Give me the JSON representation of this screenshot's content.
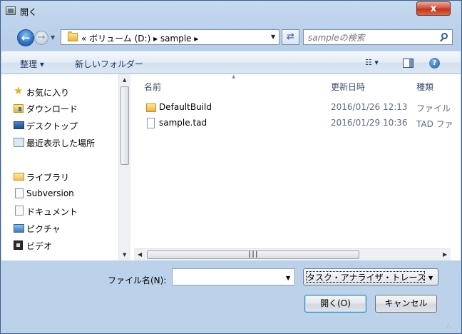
{
  "window": {
    "title": "開く",
    "close_label": "x"
  },
  "nav": {
    "address_path": "« ボリューム (D:) ▸ sample ▸",
    "search_placeholder": "sampleの検索"
  },
  "toolbar": {
    "organize_label": "整理 ▾",
    "new_folder_label": "新しいフォルダー"
  },
  "sidebar": {
    "favorites": "お気に入り",
    "downloads": "ダウンロード",
    "desktop": "デスクトップ",
    "recent": "最近表示した場所",
    "libraries": "ライブラリ",
    "subversion": "Subversion",
    "documents": "ドキュメント",
    "pictures": "ピクチャ",
    "videos": "ビデオ"
  },
  "columns": {
    "name": "名前",
    "modified": "更新日時",
    "type": "種類"
  },
  "files": [
    {
      "name": "DefaultBuild",
      "date": "2016/01/26 12:13",
      "type": "ファイル"
    },
    {
      "name": "sample.tad",
      "date": "2016/01/29 10:36",
      "type": "TAD ファ"
    }
  ],
  "bottom": {
    "filename_label": "ファイル名(N):",
    "filename_value": "",
    "filetype_value": "タスク・アナライザ・トレース",
    "open_label": "開く(O)",
    "cancel_label": "キャンセル"
  },
  "icons": {
    "back": "back-arrow-icon",
    "forward": "forward-arrow-icon",
    "refresh": "refresh-icon",
    "search": "search-icon",
    "views": "views-icon",
    "preview": "preview-pane-icon",
    "help": "help-icon"
  }
}
